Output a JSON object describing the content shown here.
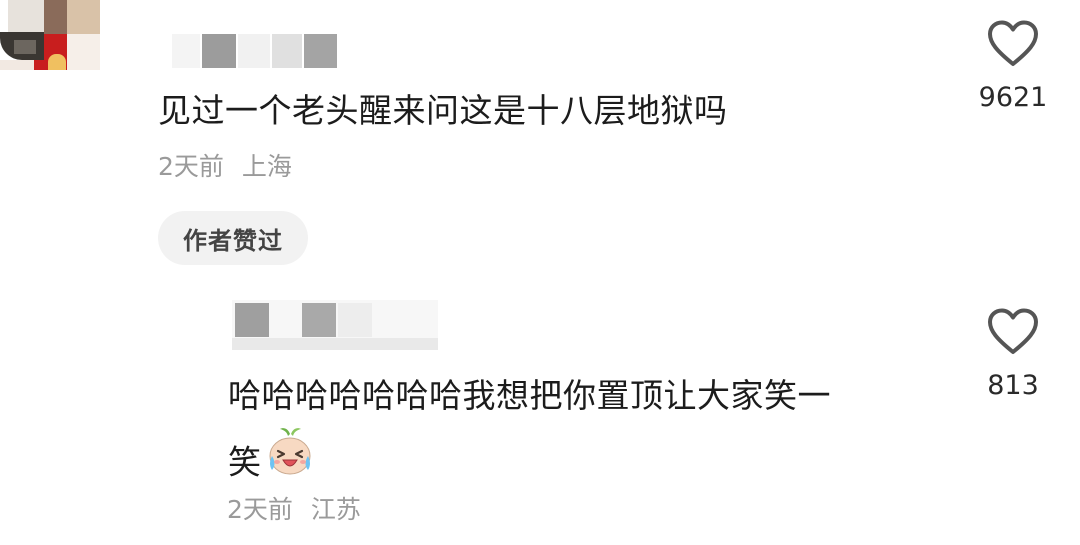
{
  "comments": [
    {
      "text": "见过一个老头醒来问这是十八层地狱吗",
      "time": "2天前",
      "location": "上海",
      "likes": "9621",
      "badge": "作者赞过"
    }
  ],
  "reply": {
    "text_line1": "哈哈哈哈哈哈哈我想把你置顶让大家笑一",
    "text_line2": "笑",
    "emoji": "laughing-crying-emoji",
    "time": "2天前",
    "location": "江苏",
    "likes": "813"
  },
  "colors": {
    "text": "#1c1c1c",
    "meta": "#9a9a9a",
    "chip_bg": "#f2f2f2",
    "heart": "#555555"
  }
}
